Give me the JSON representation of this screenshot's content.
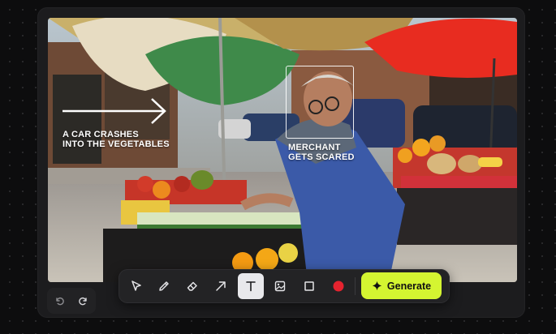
{
  "canvas": {
    "annotations": [
      {
        "id": "car",
        "text": "A CAR CRASHES\nINTO THE VEGETABLES"
      },
      {
        "id": "merchant",
        "text": "MERCHANT\nGETS SCARED"
      }
    ]
  },
  "history": {
    "undo_icon": "undo-icon",
    "redo_icon": "redo-icon"
  },
  "toolbar": {
    "tools": [
      {
        "name": "select",
        "icon": "cursor-icon",
        "active": false
      },
      {
        "name": "pencil",
        "icon": "pencil-icon",
        "active": false
      },
      {
        "name": "eraser",
        "icon": "eraser-icon",
        "active": false
      },
      {
        "name": "arrow",
        "icon": "arrow-icon",
        "active": false
      },
      {
        "name": "text",
        "icon": "text-icon",
        "active": true
      },
      {
        "name": "image",
        "icon": "image-icon",
        "active": false
      },
      {
        "name": "rectangle",
        "icon": "square-icon",
        "active": false
      },
      {
        "name": "color",
        "icon": "color-swatch",
        "active": false
      }
    ],
    "selected_color": "#e5232f",
    "generate_label": "Generate",
    "generate_color": "#d4f531"
  }
}
